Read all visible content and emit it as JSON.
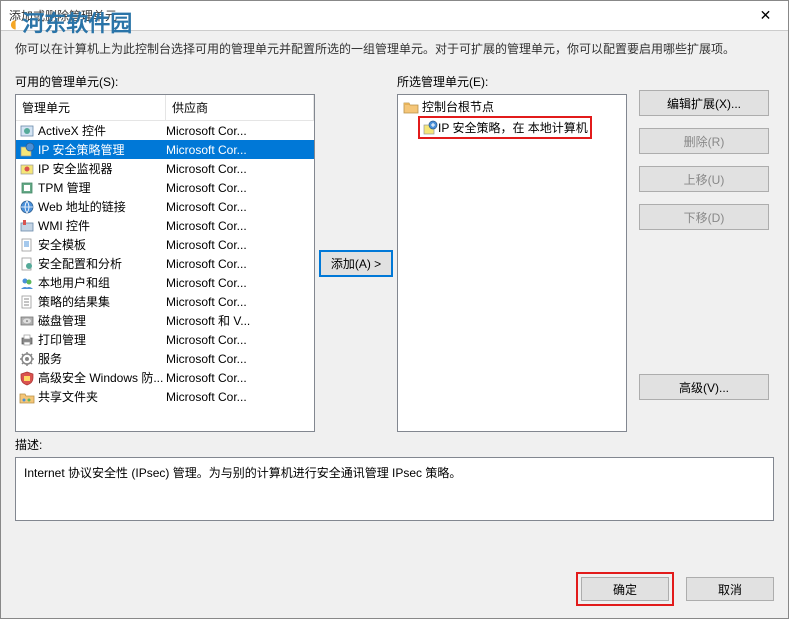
{
  "window": {
    "title": "添加或删除管理单元"
  },
  "overlay": {
    "logo": "河东软件园"
  },
  "intro": "你可以在计算机上为此控制台选择可用的管理单元并配置所选的一组管理单元。对于可扩展的管理单元，你可以配置要启用哪些扩展项。",
  "available": {
    "label": "可用的管理单元(S):",
    "cols": {
      "c1": "管理单元",
      "c2": "供应商"
    },
    "items": [
      {
        "icon": "activex-icon",
        "name": "ActiveX 控件",
        "vendor": "Microsoft Cor..."
      },
      {
        "icon": "ip-policy-icon",
        "name": "IP 安全策略管理",
        "vendor": "Microsoft Cor...",
        "selected": true
      },
      {
        "icon": "ip-monitor-icon",
        "name": "IP 安全监视器",
        "vendor": "Microsoft Cor..."
      },
      {
        "icon": "tpm-icon",
        "name": "TPM 管理",
        "vendor": "Microsoft Cor..."
      },
      {
        "icon": "web-link-icon",
        "name": "Web 地址的链接",
        "vendor": "Microsoft Cor..."
      },
      {
        "icon": "wmi-icon",
        "name": "WMI 控件",
        "vendor": "Microsoft Cor..."
      },
      {
        "icon": "template-icon",
        "name": "安全模板",
        "vendor": "Microsoft Cor..."
      },
      {
        "icon": "secconfig-icon",
        "name": "安全配置和分析",
        "vendor": "Microsoft Cor..."
      },
      {
        "icon": "users-icon",
        "name": "本地用户和组",
        "vendor": "Microsoft Cor..."
      },
      {
        "icon": "rsop-icon",
        "name": "策略的结果集",
        "vendor": "Microsoft Cor..."
      },
      {
        "icon": "disk-icon",
        "name": "磁盘管理",
        "vendor": "Microsoft 和 V..."
      },
      {
        "icon": "print-icon",
        "name": "打印管理",
        "vendor": "Microsoft Cor..."
      },
      {
        "icon": "service-icon",
        "name": "服务",
        "vendor": "Microsoft Cor..."
      },
      {
        "icon": "firewall-icon",
        "name": "高级安全 Windows 防...",
        "vendor": "Microsoft Cor..."
      },
      {
        "icon": "shared-icon",
        "name": "共享文件夹",
        "vendor": "Microsoft Cor..."
      }
    ]
  },
  "selected": {
    "label": "所选管理单元(E):",
    "root": {
      "name": "控制台根节点"
    },
    "child": {
      "name": "IP 安全策略，在 本地计算机"
    }
  },
  "buttons": {
    "add": "添加(A) >",
    "editExt": "编辑扩展(X)...",
    "remove": "删除(R)",
    "moveUp": "上移(U)",
    "moveDown": "下移(D)",
    "advanced": "高级(V)...",
    "ok": "确定",
    "cancel": "取消"
  },
  "description": {
    "label": "描述:",
    "text": "Internet 协议安全性 (IPsec) 管理。为与别的计算机进行安全通讯管理 IPsec 策略。"
  }
}
